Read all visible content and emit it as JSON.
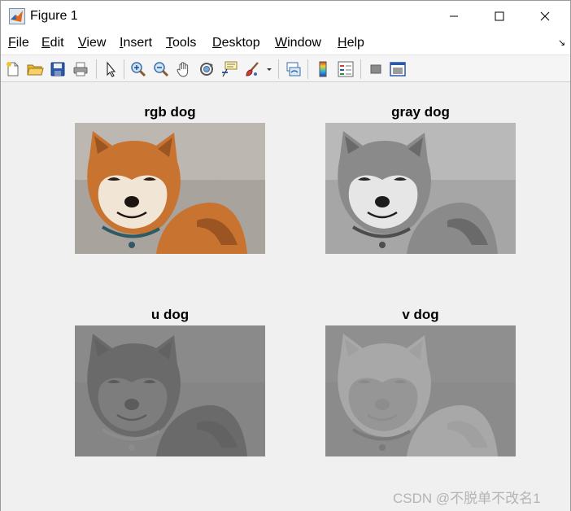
{
  "window": {
    "title": "Figure 1",
    "controls": {
      "minimize": "—",
      "maximize": "☐",
      "close": "✕"
    }
  },
  "menu": {
    "items": [
      {
        "label_ul": "F",
        "label_rest": "ile"
      },
      {
        "label_ul": "E",
        "label_rest": "dit"
      },
      {
        "label_ul": "V",
        "label_rest": "iew"
      },
      {
        "label_ul": "I",
        "label_rest": "nsert"
      },
      {
        "label_ul": "T",
        "label_rest": "ools"
      },
      {
        "label_ul": "D",
        "label_rest": "esktop"
      },
      {
        "label_ul": "W",
        "label_rest": "indow"
      },
      {
        "label_ul": "H",
        "label_rest": "elp"
      }
    ],
    "dock_arrow": "↘"
  },
  "toolbar": {
    "icons": [
      "new-figure-icon",
      "open-file-icon",
      "save-icon",
      "print-icon",
      "edit-plot-icon",
      "zoom-in-icon",
      "zoom-out-icon",
      "pan-icon",
      "rotate-3d-icon",
      "data-cursor-icon",
      "brush-icon",
      "brush-dropdown-icon",
      "link-plot-icon",
      "colorbar-icon",
      "legend-icon",
      "hide-plot-tools-icon",
      "show-plot-tools-icon"
    ]
  },
  "axes": [
    {
      "title": "rgb dog",
      "mode": "rgb"
    },
    {
      "title": "gray dog",
      "mode": "gray"
    },
    {
      "title": "u dog",
      "mode": "u"
    },
    {
      "title": "v dog",
      "mode": "v"
    }
  ],
  "colors": {
    "figure_bg": "#f0f0f0",
    "fur_orange": "#c8732f",
    "fur_cream": "#f1e6d6",
    "ground": "#a9a39e",
    "collar": "#2e5a66"
  },
  "watermark": "CSDN @不脱单不改名1"
}
